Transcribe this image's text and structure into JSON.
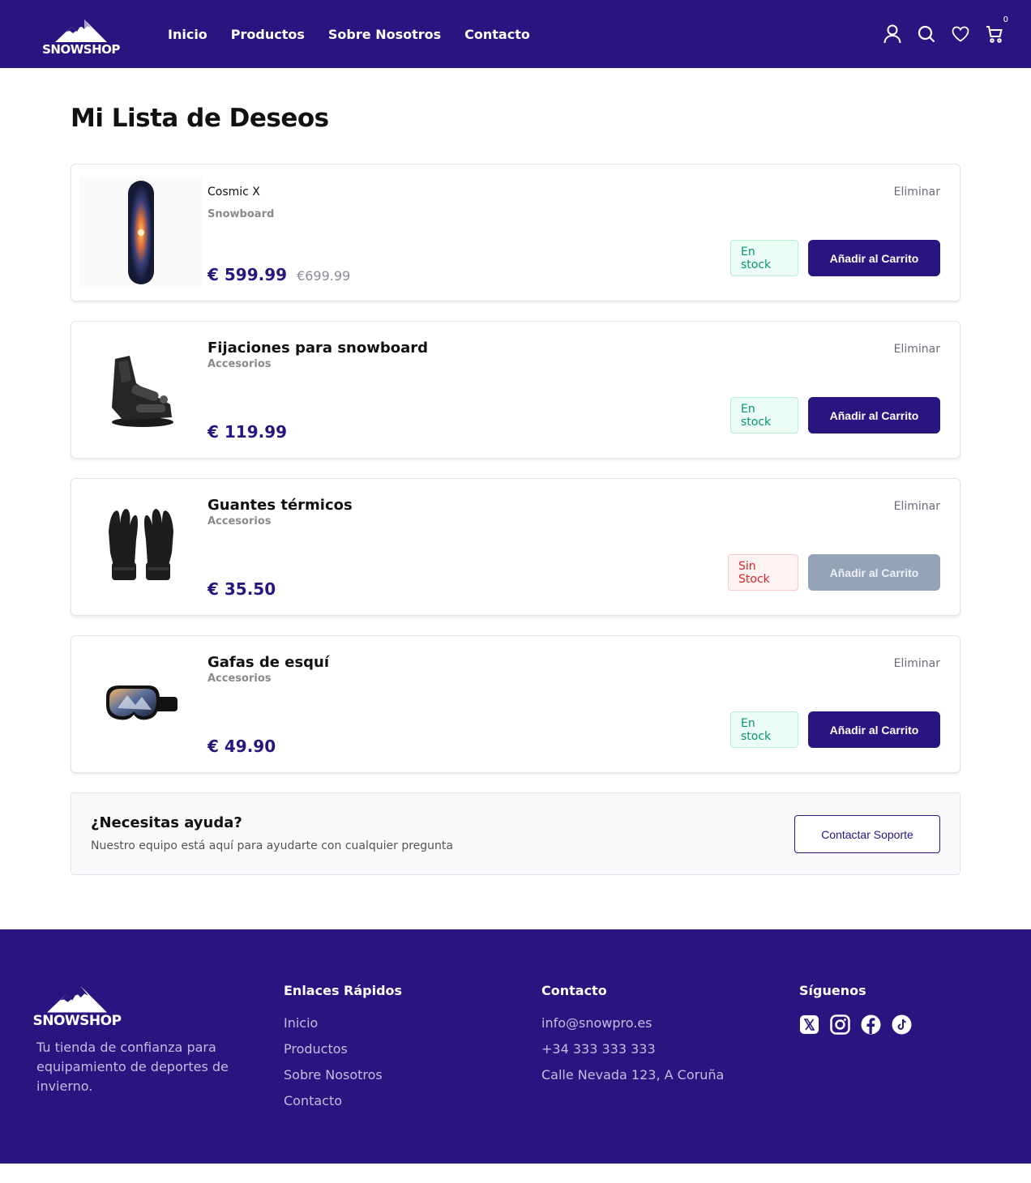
{
  "brand": {
    "name": "SNOWSHOP",
    "primary_color": "#2a1480"
  },
  "nav": {
    "inicio": "Inicio",
    "productos": "Productos",
    "sobre": "Sobre Nosotros",
    "contacto": "Contacto"
  },
  "header": {
    "cart_count": "0"
  },
  "page": {
    "title": "Mi Lista de Deseos"
  },
  "items": [
    {
      "name": "Cosmic X",
      "category": "Snowboard",
      "price": "€  599.99",
      "old_price": "€699.99",
      "stock": "En stock",
      "remove": "Eliminar",
      "cta": "Añadir al Carrito",
      "image": "snowboard"
    },
    {
      "name": "Fijaciones para snowboard",
      "category": "Accesorios",
      "price": "€  119.99",
      "stock": "En stock",
      "remove": "Eliminar",
      "cta": "Añadir al Carrito",
      "image": "binding"
    },
    {
      "name": "Guantes térmicos",
      "category": "Accesorios",
      "price": "€  35.50",
      "stock": "Sin Stock",
      "remove": "Eliminar",
      "cta": "Añadir al Carrito",
      "image": "gloves"
    },
    {
      "name": "Gafas de esquí",
      "category": "Accesorios",
      "price": "€  49.90",
      "stock": "En stock",
      "remove": "Eliminar",
      "cta": "Añadir al Carrito",
      "image": "goggles"
    }
  ],
  "help": {
    "title": "¿Necesitas ayuda?",
    "text": "Nuestro equipo está aquí para ayudarte con cualquier pregunta",
    "button": "Contactar Soporte"
  },
  "footer": {
    "tagline": "Tu tienda de confianza para equipamiento de deportes de invierno.",
    "links_title": "Enlaces Rápidos",
    "links": [
      "Inicio",
      "Productos",
      "Sobre Nosotros",
      "Contacto"
    ],
    "contact_title": "Contacto",
    "email": "info@snowpro.es",
    "phone": "+34 333 333 333",
    "address": "Calle Nevada 123, A Coruña",
    "social_title": "Síguenos",
    "socials": [
      "x-icon",
      "instagram-icon",
      "facebook-icon",
      "tiktok-icon"
    ]
  }
}
